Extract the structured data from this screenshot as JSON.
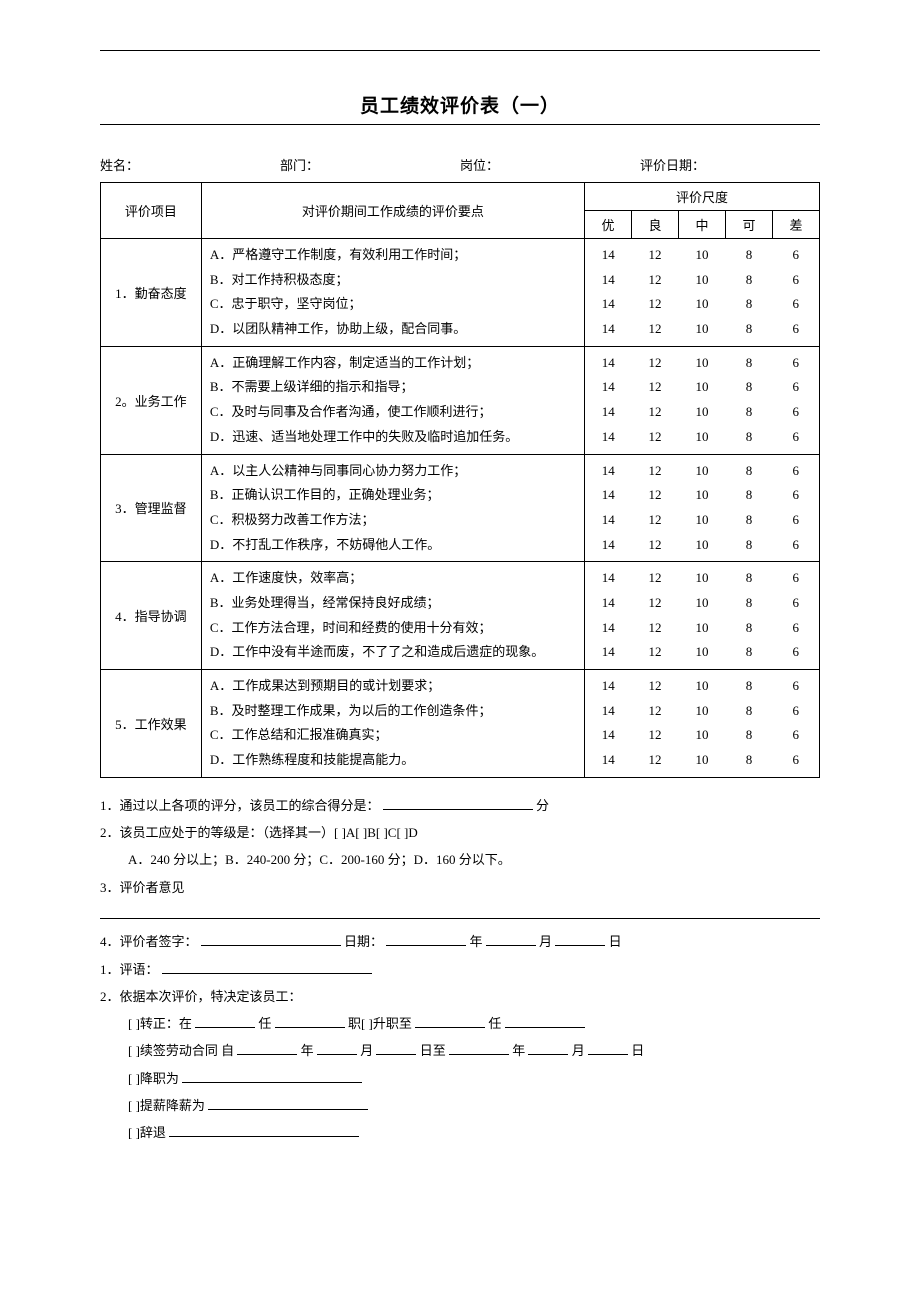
{
  "title": "员工绩效评价表（一）",
  "header": {
    "name_label": "姓名：",
    "dept_label": "部门：",
    "post_label": "岗位：",
    "date_label": "评价日期："
  },
  "table_headers": {
    "item": "评价项目",
    "criteria": "对评价期间工作成绩的评价要点",
    "scale": "评价尺度",
    "levels": [
      "优",
      "良",
      "中",
      "可",
      "差"
    ]
  },
  "score_row": [
    "14",
    "12",
    "10",
    "8",
    "6"
  ],
  "sections": [
    {
      "name": "1．勤奋态度",
      "items": [
        "A．严格遵守工作制度，有效利用工作时间；",
        "B．对工作持积极态度；",
        "C．忠于职守，坚守岗位；",
        "D．以团队精神工作，协助上级，配合同事。"
      ]
    },
    {
      "name": "2。业务工作",
      "items": [
        "A．正确理解工作内容，制定适当的工作计划；",
        "B．不需要上级详细的指示和指导；",
        "C．及时与同事及合作者沟通，使工作顺利进行；",
        "D．迅速、适当地处理工作中的失败及临时追加任务。"
      ]
    },
    {
      "name": "3．管理监督",
      "items": [
        "A．以主人公精神与同事同心协力努力工作；",
        "B．正确认识工作目的，正确处理业务；",
        "C．积极努力改善工作方法；",
        "D．不打乱工作秩序，不妨碍他人工作。"
      ]
    },
    {
      "name": "4．指导协调",
      "items": [
        "A．工作速度快，效率高；",
        "B．业务处理得当，经常保持良好成绩；",
        "C．工作方法合理，时间和经费的使用十分有效；",
        "D．工作中没有半途而废，不了了之和造成后遗症的现象。"
      ]
    },
    {
      "name": "5．工作效果",
      "items": [
        "A．工作成果达到预期目的或计划要求；",
        "B．及时整理工作成果，为以后的工作创造条件；",
        "C．工作总结和汇报准确真实；",
        "D．工作熟练程度和技能提高能力。"
      ]
    }
  ],
  "notes": {
    "n1_a": "1．通过以上各项的评分，该员工的综合得分是：",
    "n1_b": "分",
    "n2": "2．该员工应处于的等级是：（选择其一）[  ]A[  ]B[   ]C[   ]D",
    "n2_scale": "A．240 分以上；B．240-200 分；C．200-160 分；D．160 分以下。",
    "n3": "3．评价者意见",
    "n4_a": "4．评价者签字：",
    "n4_b": "日期：",
    "n4_c": "年",
    "n4_d": "月",
    "n4_e": "日",
    "n5": "1．评语：",
    "n6": "2．依据本次评价，特决定该员工：",
    "d1_a": "[   ]转正：在",
    "d1_b": "任",
    "d1_c": "职[   ]升职至",
    "d1_d": "任",
    "d2_a": "[   ]续签劳动合同   自",
    "d2_b": "年",
    "d2_c": "月",
    "d2_d": "日至",
    "d2_e": "年",
    "d2_f": "月",
    "d2_g": "日",
    "d3": "[   ]降职为",
    "d4": "[   ]提薪降薪为",
    "d5": "[   ]辞退"
  }
}
